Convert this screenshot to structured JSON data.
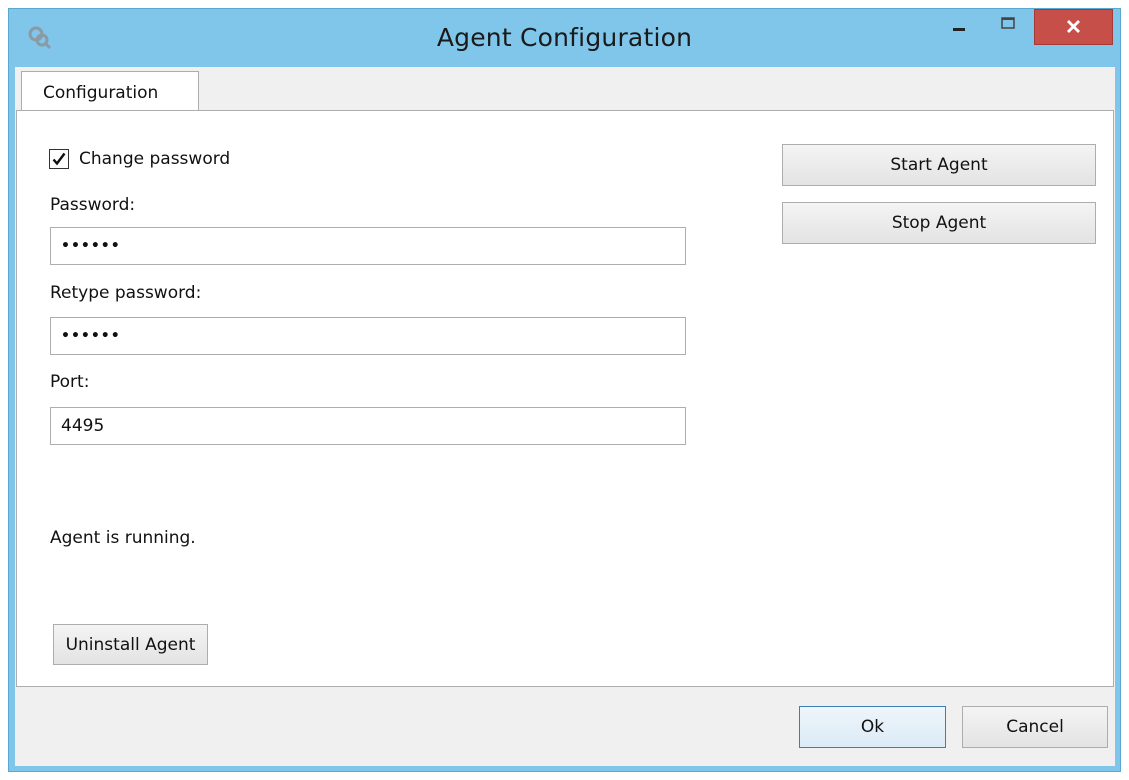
{
  "window": {
    "title": "Agent Configuration",
    "app_icon": "agent-keys-icon"
  },
  "tabs": [
    {
      "label": "Configuration",
      "selected": true
    }
  ],
  "form": {
    "change_password_label": "Change password",
    "change_password_checked": true,
    "password_label": "Password:",
    "password_value": "••••••",
    "retype_label": "Retype password:",
    "retype_value": "••••••",
    "port_label": "Port:",
    "port_value": "4495"
  },
  "status_text": "Agent is running.",
  "buttons": {
    "start_agent": "Start Agent",
    "stop_agent": "Stop Agent",
    "uninstall_agent": "Uninstall Agent",
    "ok": "Ok",
    "cancel": "Cancel"
  },
  "colors": {
    "window_frame": "#7fc6ea",
    "close_button": "#c74f4a",
    "dialog_background": "#f0f0f0"
  }
}
